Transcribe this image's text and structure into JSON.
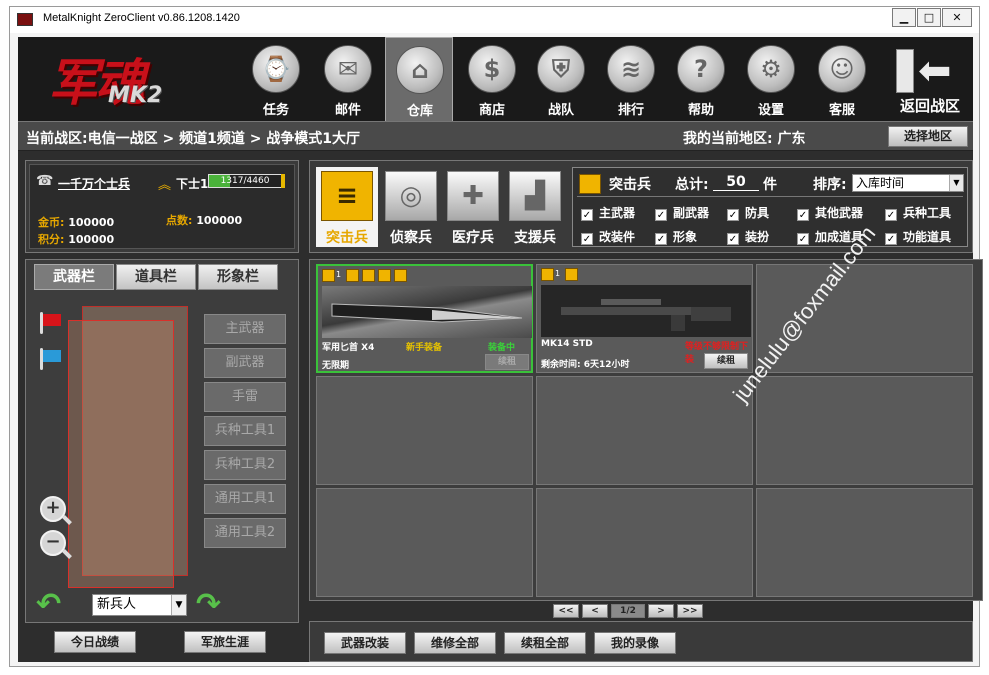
{
  "window": {
    "title": "MetalKnight ZeroClient   v0.86.1208.1420",
    "controls": {
      "minimize": "▁",
      "maximize": "□",
      "close": "✕"
    }
  },
  "logo": {
    "main": "军魂",
    "sub": "MK2"
  },
  "nav": [
    {
      "label": "任务",
      "icon": "compass-clock-icon",
      "glyph": "⌚"
    },
    {
      "label": "邮件",
      "icon": "envelope-icon",
      "glyph": "✉"
    },
    {
      "label": "仓库",
      "icon": "warehouse-icon",
      "glyph": "⌂",
      "active": true
    },
    {
      "label": "商店",
      "icon": "money-bag-icon",
      "glyph": "$"
    },
    {
      "label": "战队",
      "icon": "shield-icon",
      "glyph": "⛨"
    },
    {
      "label": "排行",
      "icon": "ranking-icon",
      "glyph": "≋"
    },
    {
      "label": "帮助",
      "icon": "question-icon",
      "glyph": "?"
    },
    {
      "label": "设置",
      "icon": "gears-icon",
      "glyph": "⚙"
    },
    {
      "label": "客服",
      "icon": "support-agent-icon",
      "glyph": "☺"
    }
  ],
  "back": {
    "label": "返回战区",
    "icon": "exit-door-icon"
  },
  "breadcrumb": {
    "text": "当前战区:电信一战区 > 频道1频道 > 战争模式1大厅",
    "region_label": "我的当前地区:",
    "region_value": "广东",
    "select_region": "选择地区"
  },
  "player": {
    "name": "一千万个士兵",
    "rank": "下士1",
    "exp_text": "1317/4460",
    "exp_progress": 0.295,
    "gold_label": "金币:",
    "gold": "100000",
    "points_label": "点数:",
    "points": "100000",
    "score_label": "积分:",
    "score": "100000"
  },
  "inventory": {
    "tabs": [
      "武器栏",
      "道具栏",
      "形象栏"
    ],
    "slots": [
      "主武器",
      "副武器",
      "手雷",
      "兵种工具1",
      "兵种工具2",
      "通用工具1",
      "通用工具2"
    ],
    "character_select": "新兵人",
    "zoom_in": "+",
    "zoom_out": "−",
    "rotate_left": "↶",
    "rotate_right": "↷",
    "today_record": "今日战绩",
    "career": "军旅生涯"
  },
  "classes": [
    {
      "label": "突击兵",
      "glyph": "≡",
      "active": true
    },
    {
      "label": "侦察兵",
      "glyph": "◎"
    },
    {
      "label": "医疗兵",
      "glyph": "✚"
    },
    {
      "label": "支援兵",
      "glyph": "▟"
    }
  ],
  "filter": {
    "title": "突击兵",
    "total_label": "总计:",
    "count": "50",
    "unit": "件",
    "sort_label": "排序:",
    "sort_value": "入库时间",
    "checkboxes": [
      "主武器",
      "副武器",
      "防具",
      "其他武器",
      "兵种工具",
      "改装件",
      "形象",
      "装扮",
      "加成道具",
      "功能道具"
    ]
  },
  "items": [
    {
      "name": "军用匕首 X4",
      "tag": "新手装备",
      "status": "装备中",
      "duration": "无限期",
      "renew": "续租",
      "level": "1"
    },
    {
      "name": "MK14 STD",
      "status": "等级不够限制下装",
      "duration": "剩余时间: 6天12小时",
      "renew": "续租",
      "level": "1"
    }
  ],
  "pager": {
    "first": "<<",
    "prev": "<",
    "page": "1/2",
    "next": ">",
    "last": ">>"
  },
  "actions": [
    "武器改装",
    "维修全部",
    "续租全部",
    "我的录像"
  ],
  "watermark": "junelulu@foxmail.com",
  "colors": {
    "accent": "#f0b400",
    "selected_border": "#3ac23a",
    "exp_bar": "#4ab23a"
  }
}
